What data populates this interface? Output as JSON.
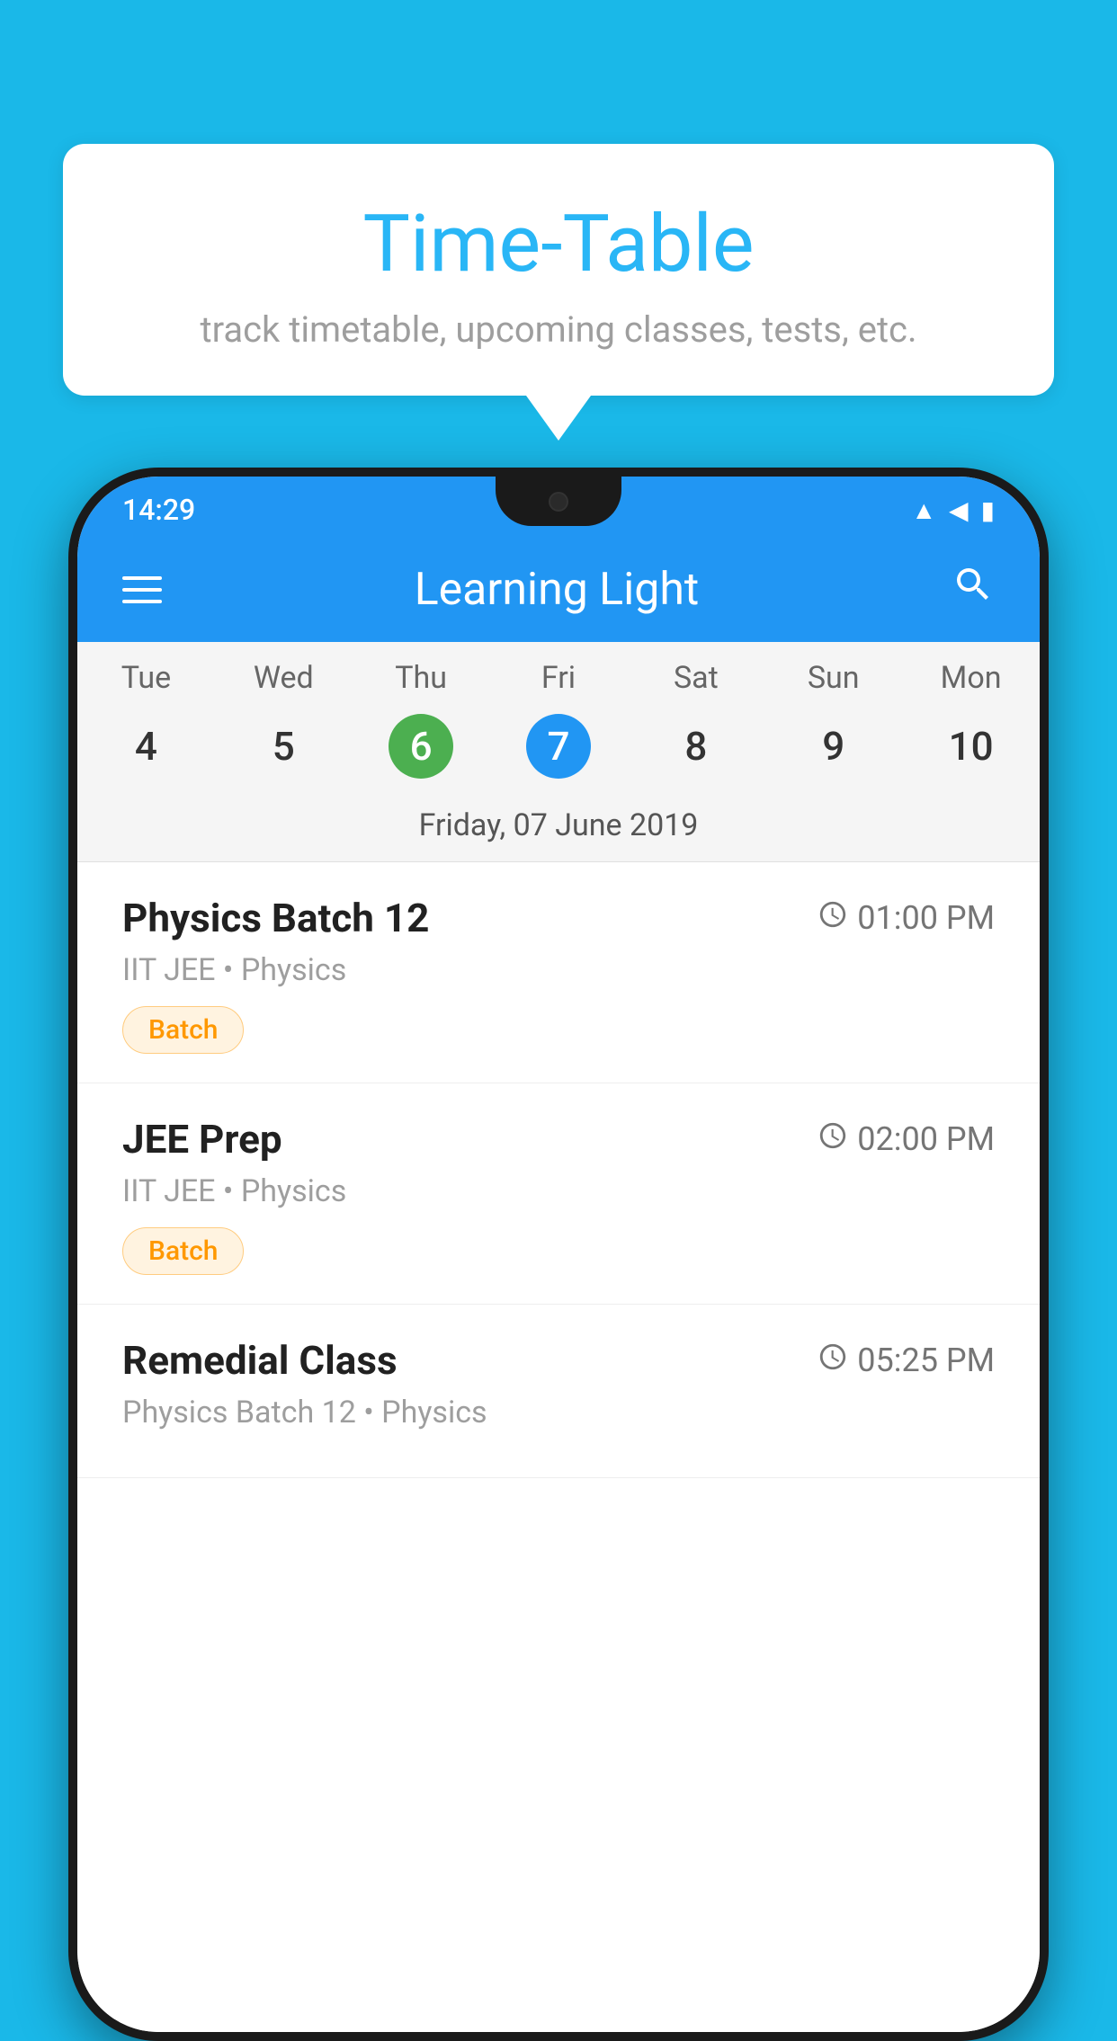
{
  "background_color": "#1ab8e8",
  "speech_bubble": {
    "title": "Time-Table",
    "subtitle": "track timetable, upcoming classes, tests, etc."
  },
  "phone": {
    "status_bar": {
      "time": "14:29",
      "wifi_icon": "▾",
      "signal_icon": "▲",
      "battery_icon": "▮"
    },
    "header": {
      "app_name": "Learning Light",
      "menu_icon": "menu",
      "search_icon": "search"
    },
    "calendar": {
      "days": [
        {
          "label": "Tue",
          "number": "4"
        },
        {
          "label": "Wed",
          "number": "5"
        },
        {
          "label": "Thu",
          "number": "6",
          "style": "green"
        },
        {
          "label": "Fri",
          "number": "7",
          "style": "blue"
        },
        {
          "label": "Sat",
          "number": "8"
        },
        {
          "label": "Sun",
          "number": "9"
        },
        {
          "label": "Mon",
          "number": "10"
        }
      ],
      "selected_date": "Friday, 07 June 2019"
    },
    "schedule": [
      {
        "title": "Physics Batch 12",
        "time": "01:00 PM",
        "subtitle": "IIT JEE • Physics",
        "tag": "Batch"
      },
      {
        "title": "JEE Prep",
        "time": "02:00 PM",
        "subtitle": "IIT JEE • Physics",
        "tag": "Batch"
      },
      {
        "title": "Remedial Class",
        "time": "05:25 PM",
        "subtitle": "Physics Batch 12 • Physics",
        "tag": ""
      }
    ]
  }
}
